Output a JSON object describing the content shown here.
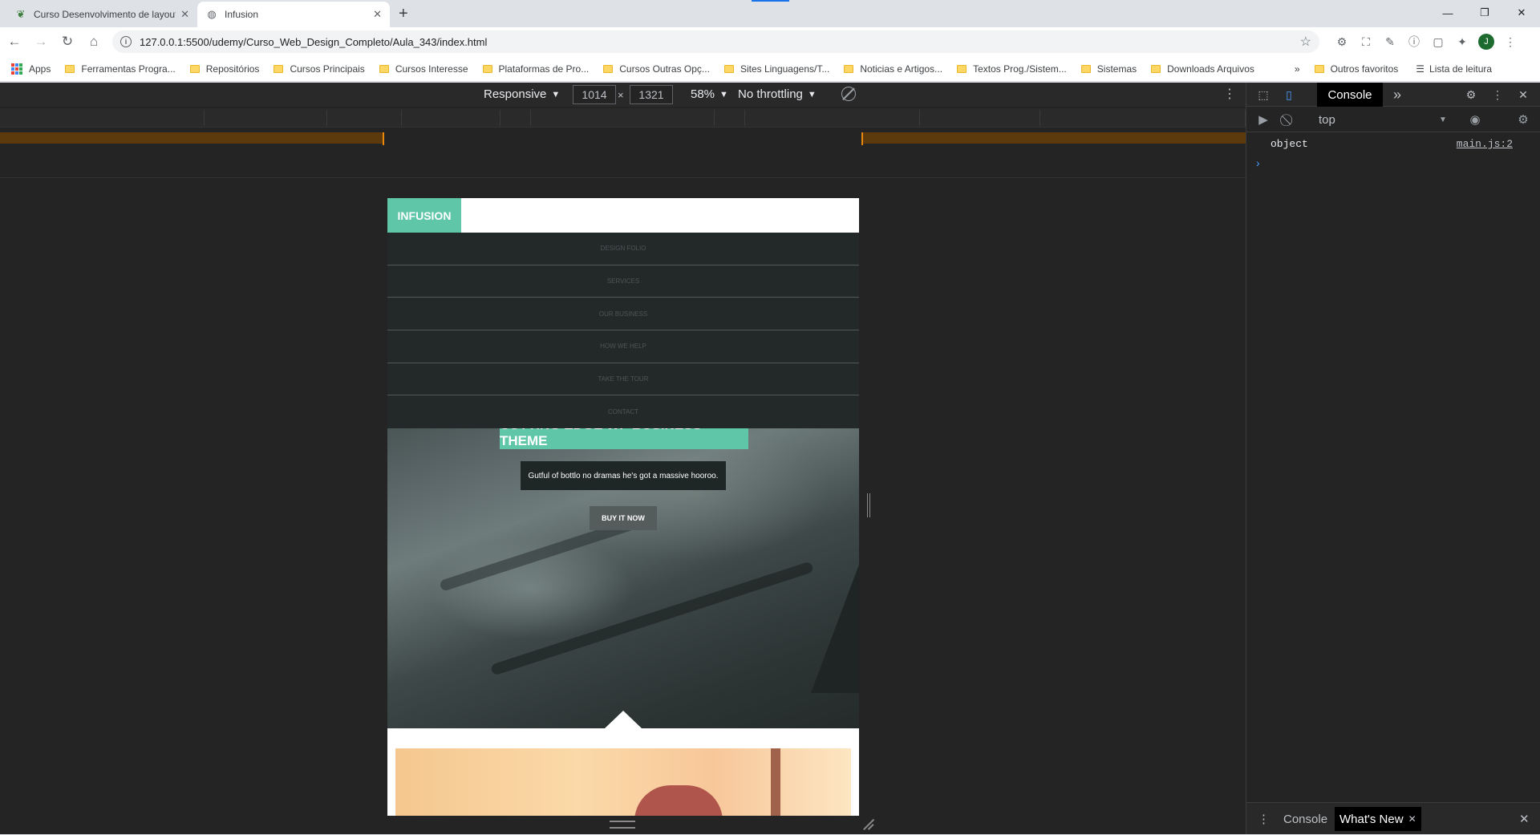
{
  "browser": {
    "tabs": [
      {
        "title": "Curso Desenvolvimento de layout",
        "icon": "udemy-favicon-icon",
        "active": false
      },
      {
        "title": "Infusion",
        "icon": "globe-icon",
        "active": true
      }
    ],
    "url": "127.0.0.1:5500/udemy/Curso_Web_Design_Completo/Aula_343/index.html",
    "profile_initial": "J",
    "bookmarks": [
      "Apps",
      "Ferramentas Progra...",
      "Repositórios",
      "Cursos Principais",
      "Cursos Interesse",
      "Plataformas de Pro...",
      "Cursos Outras Opç...",
      "Sites Linguagens/T...",
      "Noticias e Artigos...",
      "Textos Prog./Sistem...",
      "Sistemas",
      "Downloads Arquivos"
    ],
    "bookmarks_overflow": "»",
    "other_bookmarks": "Outros favoritos",
    "reading_list": "Lista de leitura"
  },
  "device_toolbar": {
    "device": "Responsive",
    "width": "1014",
    "height": "1321",
    "zoom": "58%",
    "throttling": "No throttling"
  },
  "site": {
    "logo": "INFUSION",
    "menu": [
      "DESIGN FOLIO",
      "SERVICES",
      "OUR BUSINESS",
      "HOW WE HELP",
      "TAKE THE TOUR",
      "CONTACT"
    ],
    "hero_title": "CUTTING EDGE WP BUSINESS THEME",
    "hero_subtitle": "Gutful of bottlo no dramas he's got a massive hooroo.",
    "hero_button": "BUY IT NOW"
  },
  "devtools": {
    "active_tab": "Console",
    "more_tabs": "»",
    "context": "top",
    "messages": [
      {
        "text": "object",
        "source": "main.js:2"
      }
    ],
    "prompt": "›",
    "drawer_tabs": [
      "Console",
      "What's New"
    ]
  },
  "colors": {
    "accent": "#5fc6a8",
    "menu_bg": "#232929",
    "devtools_bg": "#242424"
  }
}
